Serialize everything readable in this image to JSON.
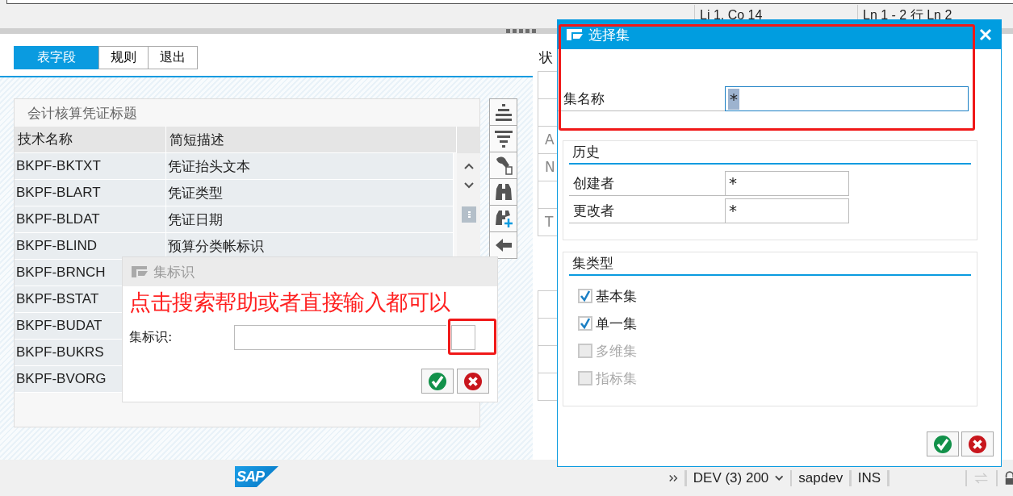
{
  "top_bar": {
    "cursor_position": "Li 1, Co 14",
    "line_info": "Ln 1 - 2 行 Ln 2"
  },
  "tabs": [
    {
      "label": "表字段",
      "selected": true
    },
    {
      "label": "规则",
      "selected": false
    },
    {
      "label": "退出",
      "selected": false
    }
  ],
  "table": {
    "title": "会计核算凭证标题",
    "columns": [
      "技术名称",
      "简短描述"
    ],
    "rows": [
      [
        "BKPF-BKTXT",
        "凭证抬头文本"
      ],
      [
        "BKPF-BLART",
        "凭证类型"
      ],
      [
        "BKPF-BLDAT",
        "凭证日期"
      ],
      [
        "BKPF-BLIND",
        "预算分类帐标识"
      ],
      [
        "BKPF-BRNCH"
      ],
      [
        "BKPF-BSTAT"
      ],
      [
        "BKPF-BUDAT"
      ],
      [
        "BKPF-BUKRS"
      ],
      [
        "BKPF-BVORG"
      ]
    ]
  },
  "side_panel": {
    "label": "状",
    "cells": [
      {},
      {},
      {
        "text": "A"
      },
      {
        "text": "N"
      },
      {},
      {
        "text": "T"
      }
    ]
  },
  "set_id_dialog": {
    "title": "集标识",
    "annotation": "点击搜索帮助或者直接输入都可以",
    "field_label": "集标识:"
  },
  "select_set_dialog": {
    "title": "选择集",
    "set_name_label": "集名称",
    "set_name_value": "*",
    "history": {
      "title": "历史",
      "fields": [
        {
          "label": "创建者",
          "value": "*"
        },
        {
          "label": "更改者",
          "value": "*"
        }
      ]
    },
    "set_type": {
      "title": "集类型",
      "options": [
        {
          "label": "基本集",
          "checked": true,
          "disabled": false
        },
        {
          "label": "单一集",
          "checked": true,
          "disabled": false
        },
        {
          "label": "多维集",
          "checked": false,
          "disabled": true
        },
        {
          "label": "指标集",
          "checked": false,
          "disabled": true
        }
      ]
    }
  },
  "status_bar": {
    "logo": "SAP",
    "system": "DEV (3) 200",
    "user": "sapdev",
    "mode": "INS"
  }
}
